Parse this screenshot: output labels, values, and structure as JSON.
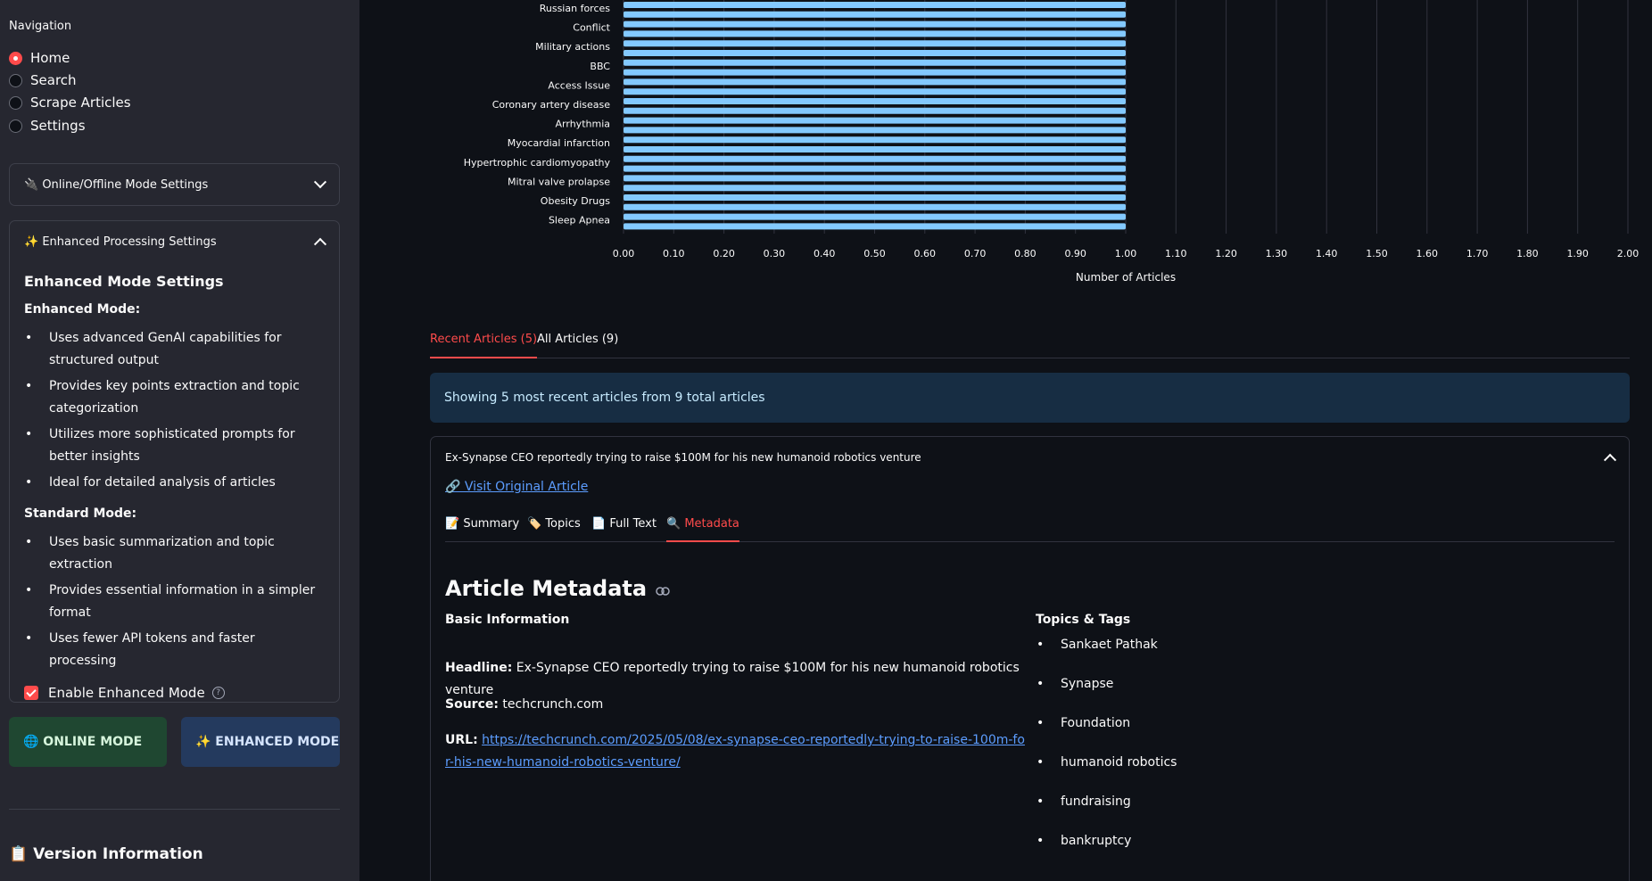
{
  "sidebar": {
    "nav_title": "Navigation",
    "nav_items": [
      {
        "label": "Home",
        "selected": true
      },
      {
        "label": "Search",
        "selected": false
      },
      {
        "label": "Scrape Articles",
        "selected": false
      },
      {
        "label": "Settings",
        "selected": false
      }
    ],
    "online_expander": {
      "title": "🔌 Online/Offline Mode Settings"
    },
    "enhanced_expander": {
      "title": "✨ Enhanced Processing Settings",
      "heading": "Enhanced Mode Settings",
      "enhanced_label": "Enhanced Mode:",
      "enhanced_points": [
        "Uses advanced GenAI capabilities for structured output",
        "Provides key points extraction and topic categorization",
        "Utilizes more sophisticated prompts for better insights",
        "Ideal for detailed analysis of articles"
      ],
      "standard_label": "Standard Mode:",
      "standard_points": [
        "Uses basic summarization and topic extraction",
        "Provides essential information in a simpler format",
        "Uses fewer API tokens and faster processing"
      ],
      "checkbox_label": "Enable Enhanced Mode",
      "checkbox_checked": true,
      "help_icon": "?"
    },
    "online_button": "🌐 ONLINE MODE",
    "enhanced_button": "✨ ENHANCED MODE",
    "version_title": "📋 Version Information"
  },
  "chart_data": {
    "type": "bar",
    "orientation": "horizontal",
    "categories": [
      "Russian forces",
      "Conflict",
      "Military actions",
      "BBC",
      "Access Issue",
      "Coronary artery disease",
      "Arrhythmia",
      "Myocardial infarction",
      "Hypertrophic cardiomyopathy",
      "Mitral valve prolapse",
      "Obesity Drugs",
      "Sleep Apnea"
    ],
    "values": [
      1,
      1,
      1,
      1,
      1,
      1,
      1,
      1,
      1,
      1,
      1,
      1
    ],
    "xlabel": "Number of Articles",
    "xlim": [
      0,
      2
    ],
    "ticks": [
      "0.00",
      "0.10",
      "0.20",
      "0.30",
      "0.40",
      "0.50",
      "0.60",
      "0.70",
      "0.80",
      "0.90",
      "1.00",
      "1.10",
      "1.20",
      "1.30",
      "1.40",
      "1.50",
      "1.60",
      "1.70",
      "1.80",
      "1.90",
      "2.00"
    ],
    "bar_color": "#83c9ff",
    "grid": true
  },
  "tabs": [
    {
      "label": "Recent Articles (5)",
      "active": true
    },
    {
      "label": "All Articles (9)",
      "active": false
    }
  ],
  "info_text": "Showing 5 most recent articles from 9 total articles",
  "article": {
    "title": "Ex-Synapse CEO reportedly trying to raise $100M for his new humanoid robotics venture",
    "visit_link": "🔗 Visit Original Article",
    "tabs": [
      {
        "label": "📝 Summary",
        "active": false
      },
      {
        "label": "🏷️ Topics",
        "active": false
      },
      {
        "label": "📄 Full Text",
        "active": false
      },
      {
        "label": "🔍 Metadata",
        "active": true
      }
    ],
    "metadata_title": "Article Metadata",
    "basic_info_label": "Basic Information",
    "headline_label": "Headline:",
    "headline": "Ex-Synapse CEO reportedly trying to raise $100M for his new humanoid robotics venture",
    "source_label": "Source:",
    "source": "techcrunch.com",
    "url_label": "URL:",
    "url": "https://techcrunch.com/2025/05/08/ex-synapse-ceo-reportedly-trying-to-raise-100m-for-his-new-humanoid-robotics-venture/",
    "topics_label": "Topics & Tags",
    "topics": [
      "Sankaet Pathak",
      "Synapse",
      "Foundation",
      "humanoid robotics",
      "fundraising",
      "bankruptcy"
    ]
  },
  "colors": {
    "accent": "#ff4b4b",
    "bar": "#83c9ff",
    "link": "#5c9dff",
    "info_bg": "#172d43"
  }
}
